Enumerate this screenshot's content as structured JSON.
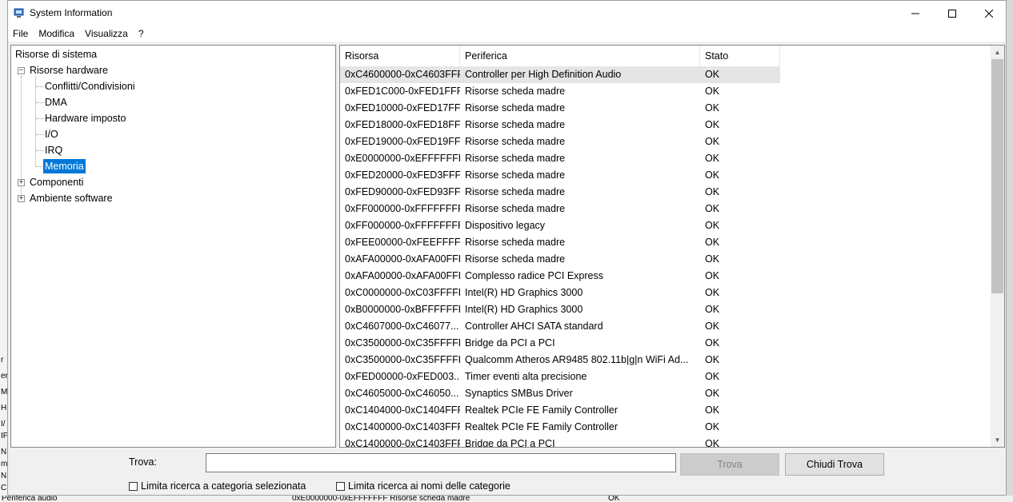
{
  "window": {
    "title": "System Information"
  },
  "menu": [
    "File",
    "Modifica",
    "Visualizza",
    "?"
  ],
  "tree": {
    "root": "Risorse di sistema",
    "hardware": "Risorse hardware",
    "children": [
      "Conflitti/Condivisioni",
      "DMA",
      "Hardware imposto",
      "I/O",
      "IRQ",
      "Memoria"
    ],
    "selected": "Memoria",
    "componenti": "Componenti",
    "software": "Ambiente software"
  },
  "table": {
    "columns": [
      "Risorsa",
      "Periferica",
      "Stato"
    ],
    "rows": [
      [
        "0xC4600000-0xC4603FFF",
        "Controller per High Definition Audio",
        "OK"
      ],
      [
        "0xFED1C000-0xFED1FFFF",
        "Risorse scheda madre",
        "OK"
      ],
      [
        "0xFED10000-0xFED17FFF",
        "Risorse scheda madre",
        "OK"
      ],
      [
        "0xFED18000-0xFED18FFF",
        "Risorse scheda madre",
        "OK"
      ],
      [
        "0xFED19000-0xFED19FFF",
        "Risorse scheda madre",
        "OK"
      ],
      [
        "0xE0000000-0xEFFFFFFF",
        "Risorse scheda madre",
        "OK"
      ],
      [
        "0xFED20000-0xFED3FFFF",
        "Risorse scheda madre",
        "OK"
      ],
      [
        "0xFED90000-0xFED93FFF",
        "Risorse scheda madre",
        "OK"
      ],
      [
        "0xFF000000-0xFFFFFFFF",
        "Risorse scheda madre",
        "OK"
      ],
      [
        "0xFF000000-0xFFFFFFFF",
        "Dispositivo legacy",
        "OK"
      ],
      [
        "0xFEE00000-0xFEEFFFFF",
        "Risorse scheda madre",
        "OK"
      ],
      [
        "0xAFA00000-0xAFA00FFF",
        "Risorse scheda madre",
        "OK"
      ],
      [
        "0xAFA00000-0xAFA00FFF",
        "Complesso radice PCI Express",
        "OK"
      ],
      [
        "0xC0000000-0xC03FFFFF",
        "Intel(R) HD Graphics 3000",
        "OK"
      ],
      [
        "0xB0000000-0xBFFFFFFF",
        "Intel(R) HD Graphics 3000",
        "OK"
      ],
      [
        "0xC4607000-0xC46077...",
        "Controller AHCI SATA standard",
        "OK"
      ],
      [
        "0xC3500000-0xC35FFFFF",
        "Bridge da PCI a PCI",
        "OK"
      ],
      [
        "0xC3500000-0xC35FFFFF",
        "Qualcomm Atheros AR9485 802.11b|g|n WiFi Ad...",
        "OK"
      ],
      [
        "0xFED00000-0xFED003...",
        "Timer eventi alta precisione",
        "OK"
      ],
      [
        "0xC4605000-0xC46050...",
        "Synaptics SMBus Driver",
        "OK"
      ],
      [
        "0xC1404000-0xC1404FFF",
        "Realtek PCIe FE Family Controller",
        "OK"
      ],
      [
        "0xC1400000-0xC1403FFF",
        "Realtek PCIe FE Family Controller",
        "OK"
      ],
      [
        "0xC1400000-0xC1403FFF",
        "Bridge da PCI a PCI",
        "OK"
      ]
    ]
  },
  "find": {
    "label": "Trova:",
    "value": "",
    "find_button": "Trova",
    "close_button": "Chiudi Trova",
    "check_category": "Limita ricerca a categoria selezionata",
    "check_names": "Limita ricerca ai nomi delle categorie"
  },
  "background": {
    "left_fragments": [
      "r",
      "er",
      "Mo",
      "H",
      "I/",
      "IF",
      "N",
      "m",
      "N",
      "C"
    ],
    "bottom_left": "Periferica audio",
    "bottom_mid": "0xE0000000-0xEFFFFFFF    Risorse scheda madre",
    "bottom_status": "OK"
  }
}
